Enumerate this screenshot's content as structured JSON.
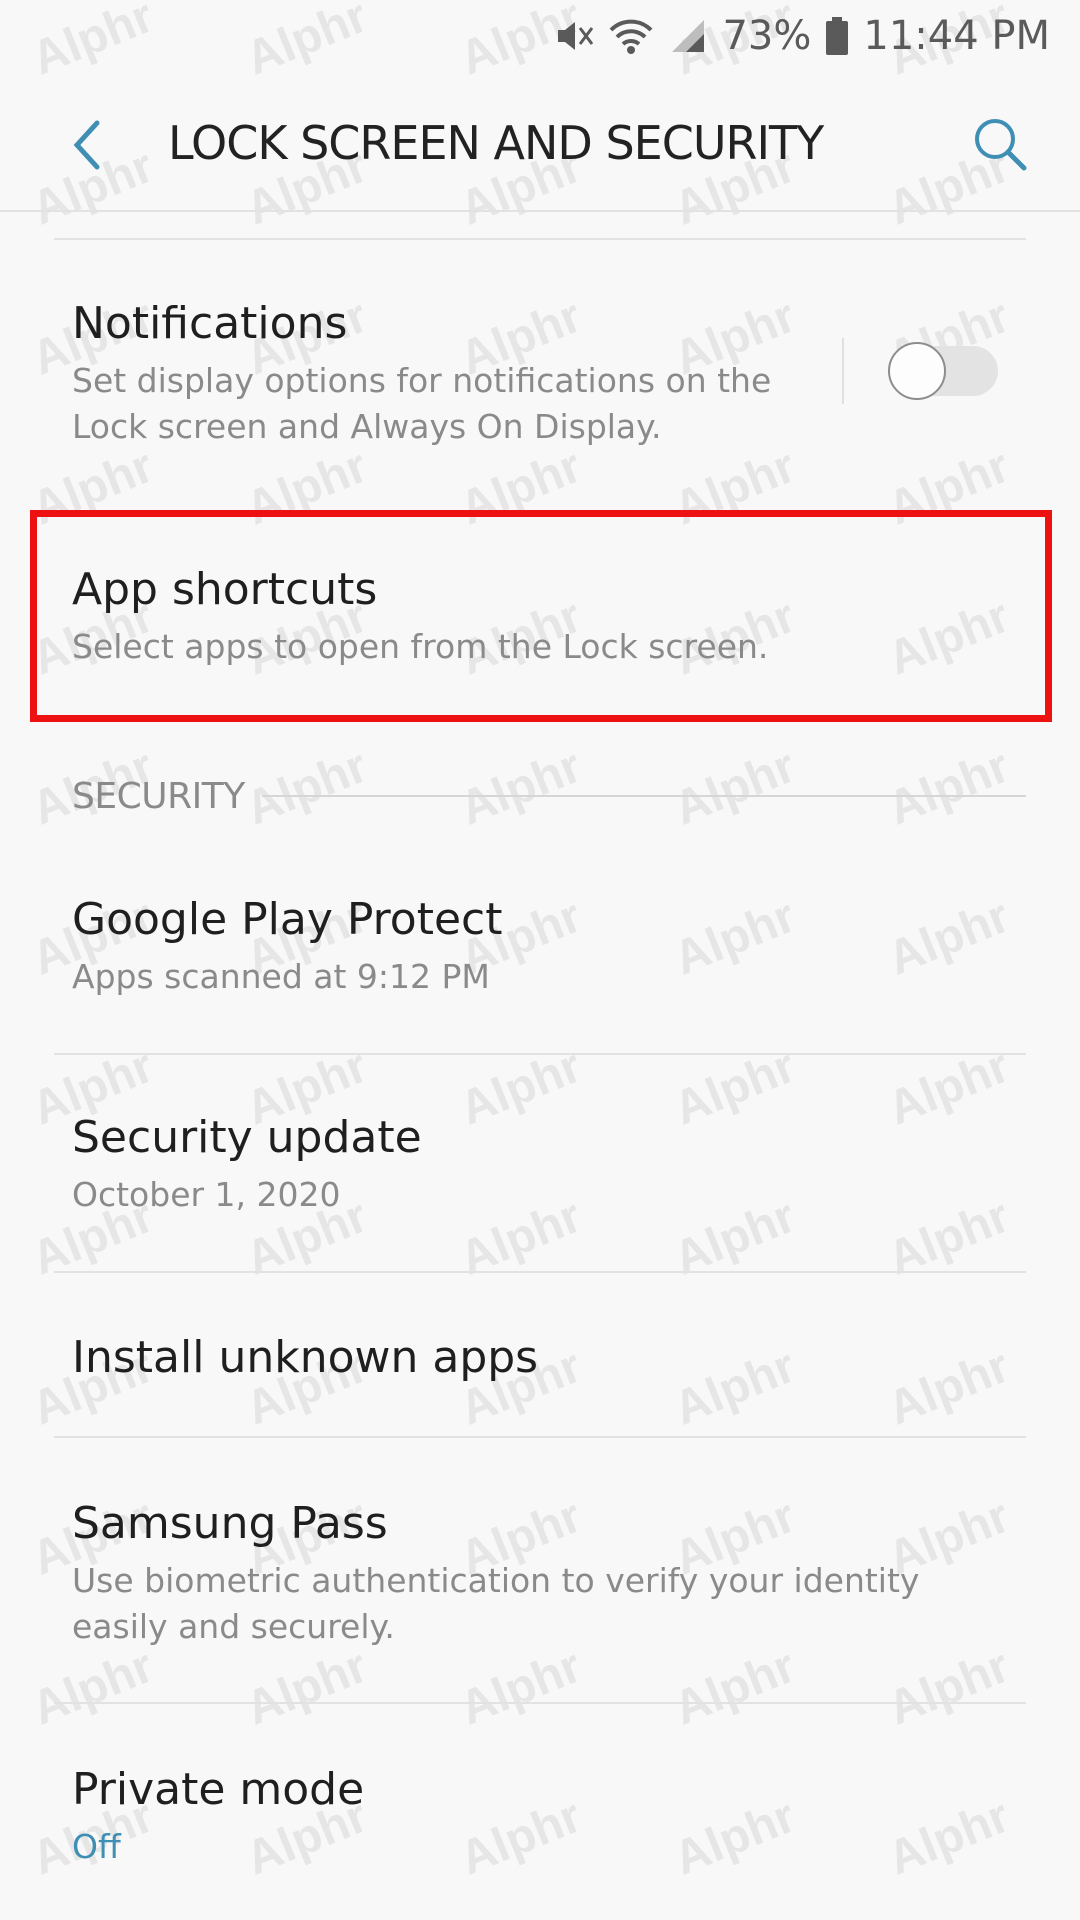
{
  "status_bar": {
    "battery": "73%",
    "time": "11:44 PM"
  },
  "header": {
    "title": "LOCK SCREEN AND SECURITY"
  },
  "items": [
    {
      "title": "Notifications",
      "subtitle": "Set display options for notifications on the Lock screen and Always On Display.",
      "toggle_on": false
    },
    {
      "title": "App shortcuts",
      "subtitle": "Select apps to open from the Lock screen."
    }
  ],
  "security_section": {
    "header": "SECURITY",
    "items": [
      {
        "title": "Google Play Protect",
        "subtitle": "Apps scanned at 9:12 PM"
      },
      {
        "title": "Security update",
        "subtitle": "October 1, 2020"
      },
      {
        "title": "Install unknown apps"
      },
      {
        "title": "Samsung Pass",
        "subtitle": "Use biometric authentication to verify your identity easily and securely."
      },
      {
        "title": "Private mode",
        "subtitle": "Off"
      }
    ]
  },
  "watermark": "Alphr",
  "colors": {
    "accent": "#3f8fb5",
    "highlight": "#ee1111",
    "background": "#f8f8f8"
  }
}
